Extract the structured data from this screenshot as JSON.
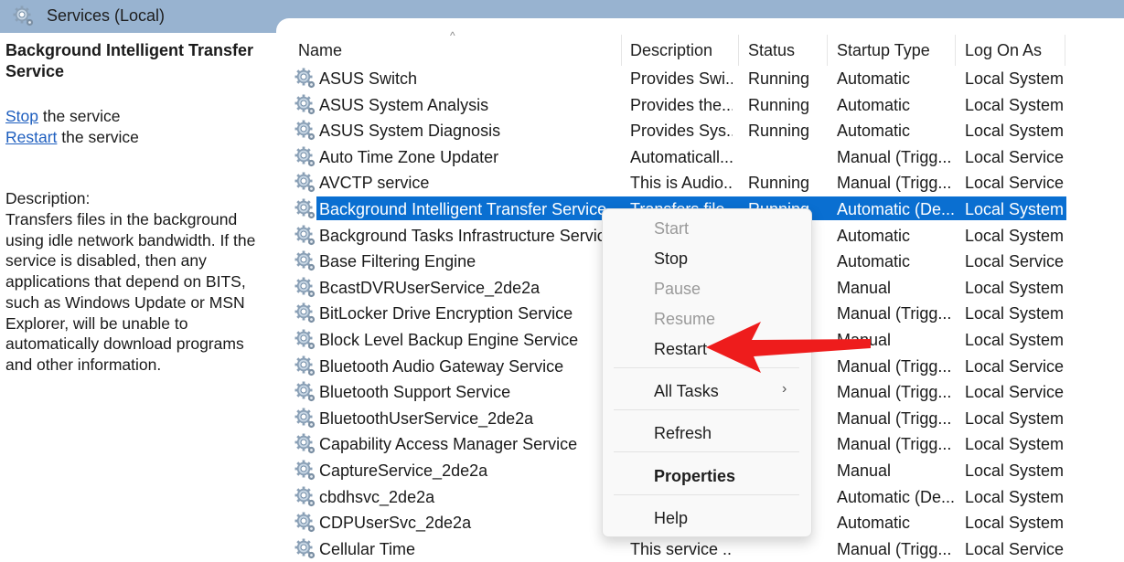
{
  "window": {
    "title": "Services (Local)"
  },
  "left_pane": {
    "service_title": "Background Intelligent Transfer Service",
    "actions": [
      {
        "link": "Stop",
        "suffix": " the service"
      },
      {
        "link": "Restart",
        "suffix": " the service"
      }
    ],
    "description_label": "Description:",
    "description_text": "Transfers files in the background using idle network bandwidth. If the service is disabled, then any applications that depend on BITS, such as Windows Update or MSN Explorer, will be unable to automatically download programs and other information."
  },
  "list": {
    "columns": [
      "Name",
      "Description",
      "Status",
      "Startup Type",
      "Log On As"
    ],
    "sort_indicator": "^",
    "rows": [
      {
        "name": "ASUS Switch",
        "description": "Provides Swi...",
        "status": "Running",
        "startup": "Automatic",
        "logon": "Local System"
      },
      {
        "name": "ASUS System Analysis",
        "description": "Provides the...",
        "status": "Running",
        "startup": "Automatic",
        "logon": "Local System"
      },
      {
        "name": "ASUS System Diagnosis",
        "description": "Provides Sys...",
        "status": "Running",
        "startup": "Automatic",
        "logon": "Local System"
      },
      {
        "name": "Auto Time Zone Updater",
        "description": "Automaticall...",
        "status": "",
        "startup": "Manual (Trigg...",
        "logon": "Local Service"
      },
      {
        "name": "AVCTP service",
        "description": "This is Audio...",
        "status": "Running",
        "startup": "Manual (Trigg...",
        "logon": "Local Service"
      },
      {
        "name": "Background Intelligent Transfer Service",
        "description": "Transfers file...",
        "status": "Running",
        "startup": "Automatic (De...",
        "logon": "Local System",
        "selected": true
      },
      {
        "name": "Background Tasks Infrastructure Service",
        "description": "",
        "status": "",
        "startup": "Automatic",
        "logon": "Local System"
      },
      {
        "name": "Base Filtering Engine",
        "description": "",
        "status": "",
        "startup": "Automatic",
        "logon": "Local Service"
      },
      {
        "name": "BcastDVRUserService_2de2a",
        "description": "",
        "status": "",
        "startup": "Manual",
        "logon": "Local System"
      },
      {
        "name": "BitLocker Drive Encryption Service",
        "description": "",
        "status": "",
        "startup": "Manual (Trigg...",
        "logon": "Local System"
      },
      {
        "name": "Block Level Backup Engine Service",
        "description": "",
        "status": "",
        "startup": "Manual",
        "logon": "Local System"
      },
      {
        "name": "Bluetooth Audio Gateway Service",
        "description": "",
        "status": "",
        "startup": "Manual (Trigg...",
        "logon": "Local Service"
      },
      {
        "name": "Bluetooth Support Service",
        "description": "",
        "status": "",
        "startup": "Manual (Trigg...",
        "logon": "Local Service"
      },
      {
        "name": "BluetoothUserService_2de2a",
        "description": "",
        "status": "",
        "startup": "Manual (Trigg...",
        "logon": "Local System"
      },
      {
        "name": "Capability Access Manager Service",
        "description": "",
        "status": "",
        "startup": "Manual (Trigg...",
        "logon": "Local System"
      },
      {
        "name": "CaptureService_2de2a",
        "description": "",
        "status": "",
        "startup": "Manual",
        "logon": "Local System"
      },
      {
        "name": "cbdhsvc_2de2a",
        "description": "",
        "status": "",
        "startup": "Automatic (De...",
        "logon": "Local System"
      },
      {
        "name": "CDPUserSvc_2de2a",
        "description": "",
        "status": "",
        "startup": "Automatic",
        "logon": "Local System"
      },
      {
        "name": "Cellular Time",
        "description": "This service ...",
        "status": "",
        "startup": "Manual (Trigg...",
        "logon": "Local Service"
      }
    ]
  },
  "context_menu": {
    "items": [
      {
        "label": "Start",
        "disabled": true
      },
      {
        "label": "Stop",
        "disabled": false
      },
      {
        "label": "Pause",
        "disabled": true
      },
      {
        "label": "Resume",
        "disabled": true
      },
      {
        "label": "Restart",
        "disabled": false,
        "highlighted_by_arrow": true
      },
      {
        "label": "All Tasks",
        "disabled": false,
        "submenu": true
      },
      {
        "label": "Refresh",
        "disabled": false
      },
      {
        "label": "Properties",
        "disabled": false,
        "bold": true
      },
      {
        "label": "Help",
        "disabled": false
      }
    ],
    "submenu_glyph": "›"
  },
  "annotation": {
    "type": "arrow",
    "points_to": "Restart",
    "color": "#ee1c1c"
  },
  "colors": {
    "titlebar": "#98b3d0",
    "selection": "#0a6fd1",
    "link": "#1f5fbf"
  }
}
